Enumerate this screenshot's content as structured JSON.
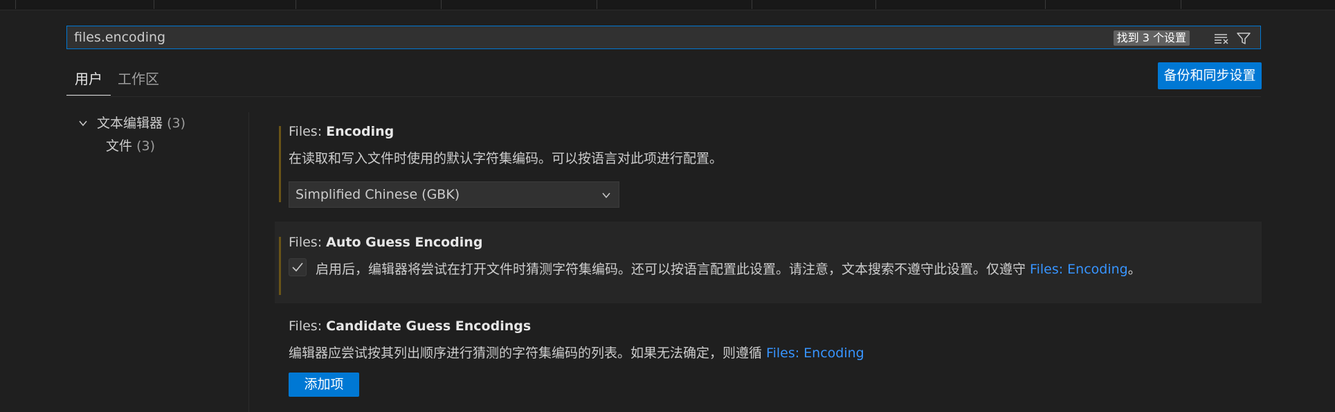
{
  "search": {
    "value": "files.encoding",
    "result_count": "找到 3 个设置",
    "icons": [
      "clear-filter-icon",
      "filter-icon"
    ]
  },
  "tabs": [
    {
      "label": "用户",
      "active": true
    },
    {
      "label": "工作区",
      "active": false
    }
  ],
  "sync_button": "备份和同步设置",
  "toc": {
    "items": [
      {
        "label": "文本编辑器",
        "count": "(3)",
        "expanded": true
      },
      {
        "label": "文件",
        "count": "(3)"
      }
    ]
  },
  "settings": [
    {
      "category": "Files: ",
      "name": "Encoding",
      "description": "在读取和写入文件时使用的默认字符集编码。可以按语言对此项进行配置。",
      "value": "Simplified Chinese (GBK)"
    },
    {
      "category": "Files: ",
      "name": "Auto Guess Encoding",
      "checked": true,
      "description": "启用后，编辑器将尝试在打开文件时猜测字符集编码。还可以按语言配置此设置。请注意，文本搜索不遵守此设置。仅遵守 ",
      "link": "Files: Encoding",
      "suffix": "。"
    },
    {
      "category": "Files: ",
      "name": "Candidate Guess Encodings",
      "description": "编辑器应尝试按其列出顺序进行猜测的字符集编码的列表。如果无法确定，则遵循 ",
      "link": "Files: Encoding",
      "button": "添加项"
    }
  ],
  "colors": {
    "background": "#1f1f1f",
    "accent": "#0078d4",
    "link": "#3794ff",
    "modified_indicator": "#6a5417"
  }
}
